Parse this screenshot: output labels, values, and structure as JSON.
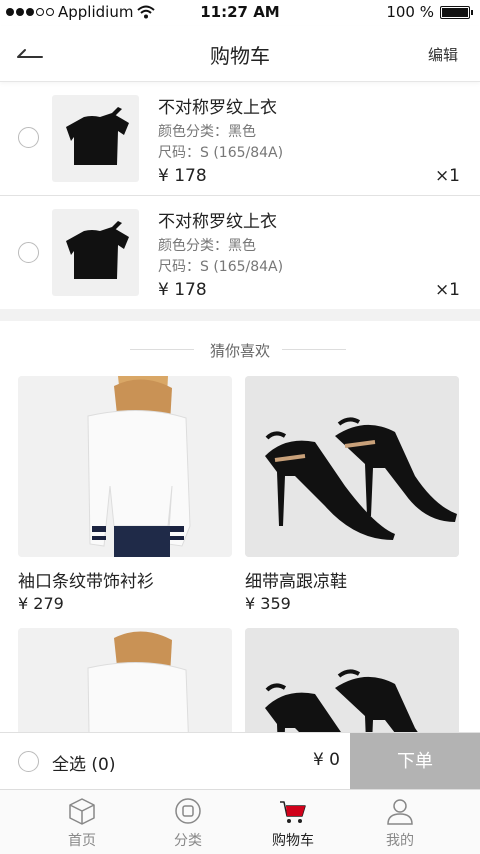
{
  "status_bar": {
    "carrier": "Applidium",
    "time": "11:27 AM",
    "battery": "100 %"
  },
  "nav": {
    "title": "购物车",
    "edit_label": "编辑"
  },
  "cart": {
    "items": [
      {
        "name": "不对称罗纹上衣",
        "color": "颜色分类：黑色",
        "size": "尺码：S (165/84A)",
        "price": "¥ 178",
        "qty": "×1"
      },
      {
        "name": "不对称罗纹上衣",
        "color": "颜色分类：黑色",
        "size": "尺码：S (165/84A)",
        "price": "¥ 178",
        "qty": "×1"
      }
    ]
  },
  "recommend": {
    "header": "猜你喜欢",
    "products": [
      {
        "name": "袖口条纹带饰衬衫",
        "price": "¥ 279"
      },
      {
        "name": "细带高跟凉鞋",
        "price": "¥ 359"
      }
    ]
  },
  "checkout": {
    "select_all": "全选 (0)",
    "total": "¥ 0",
    "submit_label": "下单"
  },
  "tabs": [
    {
      "label": "首页",
      "icon": "box-icon"
    },
    {
      "label": "分类",
      "icon": "category-icon"
    },
    {
      "label": "购物车",
      "icon": "cart-icon"
    },
    {
      "label": "我的",
      "icon": "user-icon"
    }
  ],
  "colors": {
    "accent": "#d0021b",
    "submit_bg": "#b3b3b3"
  }
}
